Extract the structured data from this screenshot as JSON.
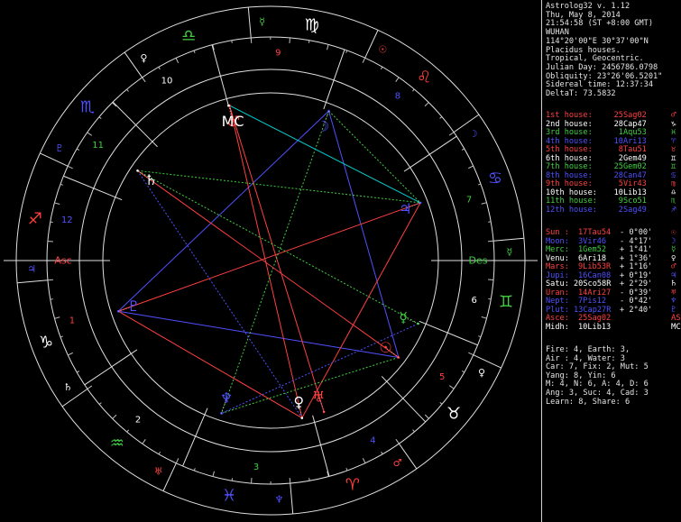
{
  "header": {
    "lines": [
      "Astrolog32 v. 1.12",
      "Thu, May 8, 2014",
      "21:54:58 (ST +8:00 GMT)",
      "WUHAN",
      "114°20'00\"E 30°37'00\"N",
      "Placidus houses.",
      "Tropical, Geocentric.",
      "Julian Day: 2456786.0798",
      "Obliquity: 23°26'06.5201\"",
      "Sidereal time: 12:37:34",
      "DeltaT: 73.5832"
    ]
  },
  "houses": [
    {
      "label": "1st house:",
      "value": "25Sag02",
      "color": "#ff4040",
      "icon": "♂"
    },
    {
      "label": "2nd house:",
      "value": "28Cap47",
      "color": "#ffffff",
      "icon": "♑"
    },
    {
      "label": "3rd house:",
      "value": "1Aqu53",
      "color": "#40d040",
      "icon": "♓"
    },
    {
      "label": "4th house:",
      "value": "10Ari13",
      "color": "#5050ff",
      "icon": "♈"
    },
    {
      "label": "5th house:",
      "value": "8Tau51",
      "color": "#ff4040",
      "icon": "♉"
    },
    {
      "label": "6th house:",
      "value": "2Gem49",
      "color": "#ffffff",
      "icon": "♊"
    },
    {
      "label": "7th house:",
      "value": "25Gem02",
      "color": "#40d040",
      "icon": "♊"
    },
    {
      "label": "8th house:",
      "value": "28Can47",
      "color": "#5050ff",
      "icon": "♋"
    },
    {
      "label": "9th house:",
      "value": "5Vir43",
      "color": "#ff4040",
      "icon": "♍"
    },
    {
      "label": "10th house:",
      "value": "10Lib13",
      "color": "#ffffff",
      "icon": "♎"
    },
    {
      "label": "11th house:",
      "value": "9Sco51",
      "color": "#40d040",
      "icon": "♏"
    },
    {
      "label": "12th house:",
      "value": "2Sag49",
      "color": "#5050ff",
      "icon": "♐"
    }
  ],
  "planets": [
    {
      "label": "Sun :",
      "value": "17Tau54",
      "extra": "- 0°00'",
      "color": "#ff4040",
      "icon": "☉"
    },
    {
      "label": "Moon:",
      "value": "3Vir46",
      "extra": "- 4°17'",
      "color": "#5050ff",
      "icon": "☽"
    },
    {
      "label": "Merc:",
      "value": "1Gem52",
      "extra": "+ 1°41'",
      "color": "#40d040",
      "icon": "☿"
    },
    {
      "label": "Venu:",
      "value": "6Ari18",
      "extra": "+ 1°36'",
      "color": "#ffffff",
      "icon": "♀"
    },
    {
      "label": "Mars:",
      "value": "9Lib53R",
      "extra": "+ 1°16'",
      "color": "#ff4040",
      "icon": "♂"
    },
    {
      "label": "Jupi:",
      "value": "16Can08",
      "extra": "+ 0°19'",
      "color": "#5050ff",
      "icon": "♃"
    },
    {
      "label": "Satu:",
      "value": "20Sco58R",
      "extra": "+ 2°29'",
      "color": "#ffffff",
      "icon": "♄"
    },
    {
      "label": "Uran:",
      "value": "14Ari27",
      "extra": "- 0°39'",
      "color": "#ff4040",
      "icon": "♅"
    },
    {
      "label": "Nept:",
      "value": "7Pis12",
      "extra": "- 0°42'",
      "color": "#5050ff",
      "icon": "♆"
    },
    {
      "label": "Plut:",
      "value": "13Cap27R",
      "extra": "+ 2°40'",
      "color": "#5050ff",
      "icon": "♇"
    },
    {
      "label": "Asce:",
      "value": "25Sag02",
      "extra": "",
      "color": "#ff4040",
      "icon": "AS"
    },
    {
      "label": "Midh:",
      "value": "10Lib13",
      "extra": "",
      "color": "#ffffff",
      "icon": "MC"
    }
  ],
  "stats": [
    "Fire: 4, Earth: 3,",
    "Air : 4, Water: 3",
    "Car: 7, Fix: 2, Mut: 5",
    "Yang: 8, Yin: 6",
    "M: 4, N: 6, A: 4, D: 6",
    "Ang: 3, Suc: 4, Cad: 3",
    "Learn: 8, Share: 6"
  ],
  "wheel": {
    "asc_text": "Asc",
    "des_text": "Des",
    "signs": [
      {
        "glyph": "♐",
        "color": "#ff4040"
      },
      {
        "glyph": "♑",
        "color": "#ffffff"
      },
      {
        "glyph": "♒",
        "color": "#40d040"
      },
      {
        "glyph": "♓",
        "color": "#5050ff"
      },
      {
        "glyph": "♈",
        "color": "#ff4040"
      },
      {
        "glyph": "♉",
        "color": "#ffffff"
      },
      {
        "glyph": "♊",
        "color": "#40d040"
      },
      {
        "glyph": "♋",
        "color": "#5050ff"
      },
      {
        "glyph": "♌",
        "color": "#ff4040"
      },
      {
        "glyph": "♍",
        "color": "#ffffff"
      },
      {
        "glyph": "♎",
        "color": "#40d040"
      },
      {
        "glyph": "♏",
        "color": "#5050ff"
      }
    ],
    "house_numbers": [
      {
        "n": "1",
        "color": "#ff4040"
      },
      {
        "n": "2",
        "color": "#ffffff"
      },
      {
        "n": "3",
        "color": "#40d040"
      },
      {
        "n": "4",
        "color": "#5050ff"
      },
      {
        "n": "5",
        "color": "#ff4040"
      },
      {
        "n": "6",
        "color": "#ffffff"
      },
      {
        "n": "7",
        "color": "#40d040"
      },
      {
        "n": "8",
        "color": "#5050ff"
      },
      {
        "n": "9",
        "color": "#ff4040"
      },
      {
        "n": "10",
        "color": "#ffffff"
      },
      {
        "n": "11",
        "color": "#40d040"
      },
      {
        "n": "12",
        "color": "#5050ff"
      }
    ],
    "ruler_glyphs": [
      {
        "glyph": "♃",
        "color": "#5050ff"
      },
      {
        "glyph": "♄",
        "color": "#ffffff"
      },
      {
        "glyph": "♅",
        "color": "#ff4040"
      },
      {
        "glyph": "♆",
        "color": "#5050ff"
      },
      {
        "glyph": "♂",
        "color": "#ff4040"
      },
      {
        "glyph": "♀",
        "color": "#ffffff"
      },
      {
        "glyph": "☿",
        "color": "#40d040"
      },
      {
        "glyph": "☽",
        "color": "#5050ff"
      },
      {
        "glyph": "☉",
        "color": "#ff4040"
      },
      {
        "glyph": "☿",
        "color": "#40d040"
      },
      {
        "glyph": "♀",
        "color": "#ffffff"
      },
      {
        "glyph": "♇",
        "color": "#5050ff"
      }
    ],
    "points": [
      {
        "glyph": "☉",
        "color": "#ff4040"
      },
      {
        "glyph": "☽",
        "color": "#5050ff"
      },
      {
        "glyph": "☿",
        "color": "#40d040"
      },
      {
        "glyph": "♀",
        "color": "#ffffff"
      },
      {
        "glyph": "♂",
        "color": "#ff4040"
      },
      {
        "glyph": "♃",
        "color": "#5050ff"
      },
      {
        "glyph": "♄",
        "color": "#ffffff"
      },
      {
        "glyph": "♅",
        "color": "#ff4040"
      },
      {
        "glyph": "♆",
        "color": "#5050ff"
      },
      {
        "glyph": "♇",
        "color": "#5050ff"
      },
      {
        "glyph": "MC",
        "color": "#ffffff"
      }
    ]
  }
}
